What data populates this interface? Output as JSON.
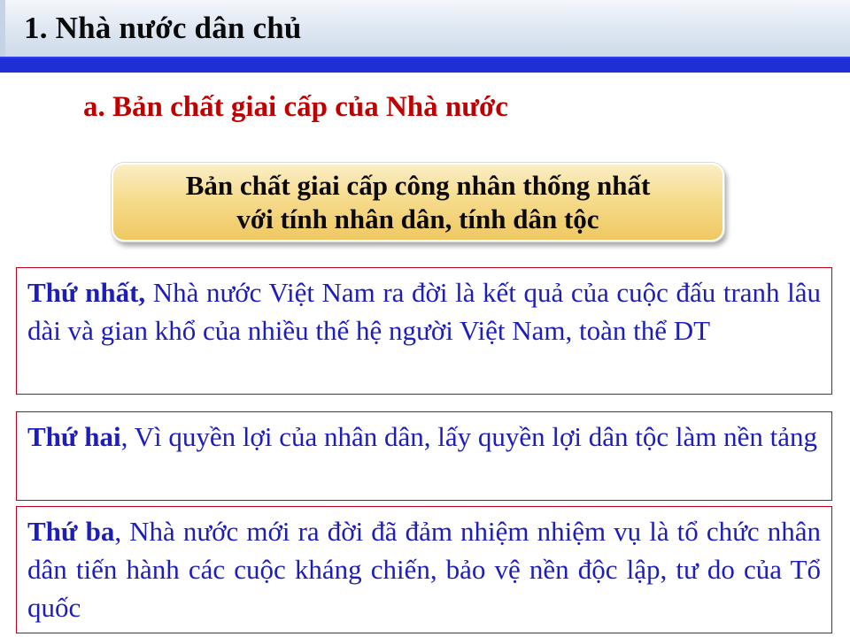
{
  "header": {
    "title": "1. Nhà nước dân chủ"
  },
  "section": {
    "subheading": "a. Bản chất giai cấp của Nhà nước"
  },
  "summary": {
    "line1": "Bản chất giai cấp công nhân thống nhất",
    "line2": "với tính nhân dân, tính dân tộc"
  },
  "points": [
    {
      "lead": "Thứ nhất,",
      "text": " Nhà nước Việt Nam ra đời là kết quả của cuộc đấu tranh lâu dài và gian khổ của nhiều thế hệ người Việt Nam, toàn thể DT"
    },
    {
      "lead": "Thứ hai",
      "text": ", Vì quyền lợi của nhân dân, lấy quyền lợi dân tộc làm nền tảng"
    },
    {
      "lead": "Thứ ba",
      "text": ", Nhà nước mới ra đời đã đảm nhiệm nhiệm vụ là tổ chức nhân dân tiến hành các cuộc kháng chiến, bảo vệ nền độc lập, tư do của Tổ quốc"
    }
  ],
  "colors": {
    "title_stripe": "#1f2fd6",
    "subheading": "#c00000",
    "body_text": "#1d1dbb",
    "box_border": "#c0001a",
    "gold_box": "#f6dc8e"
  }
}
